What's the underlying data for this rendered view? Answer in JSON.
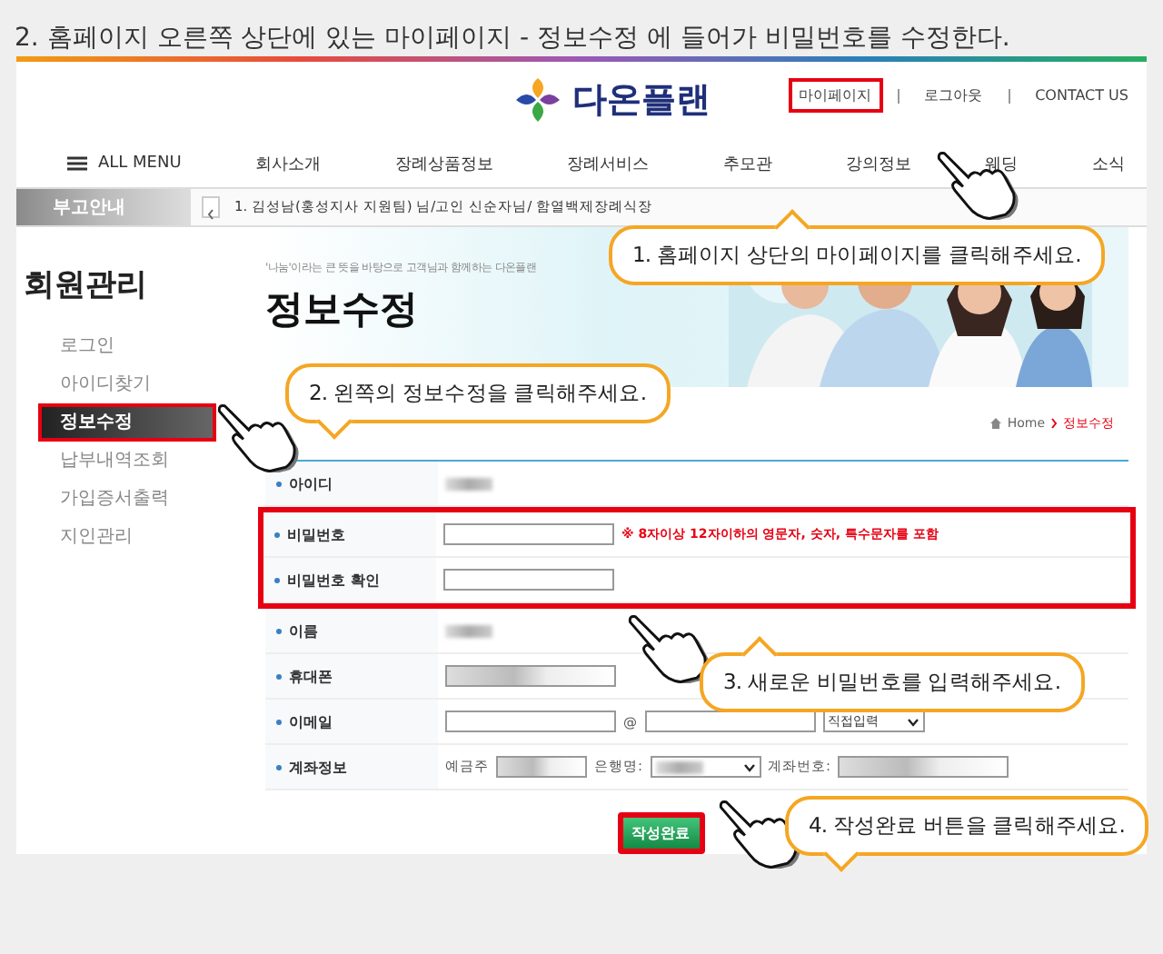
{
  "instruction": "2.  홈페이지 오른쪽 상단에 있는 마이페이지 - 정보수정 에 들어가 비밀번호를 수정한다.",
  "site": {
    "logo_text": "다온플랜",
    "top_links": [
      {
        "label": "마이페이지",
        "highlighted": true
      },
      {
        "label": "로그아웃",
        "highlighted": false
      },
      {
        "label": "CONTACT US",
        "highlighted": false
      }
    ],
    "menu_label": "ALL MENU",
    "nav": [
      "회사소개",
      "장례상품정보",
      "장례서비스",
      "추모관",
      "강의정보",
      "웨딩",
      "소식"
    ],
    "notice": {
      "label": "부고안내",
      "item": "1. 김성남(홍성지사 지원팀) 님/고인 신순자님/ 함열백제장례식장"
    }
  },
  "sidebar": {
    "title": "회원관리",
    "items": [
      {
        "label": "로그인",
        "selected": false
      },
      {
        "label": "아이디찾기",
        "selected": false
      },
      {
        "label": "정보수정",
        "selected": true
      },
      {
        "label": "납부내역조회",
        "selected": false
      },
      {
        "label": "가입증서출력",
        "selected": false
      },
      {
        "label": "지인관리",
        "selected": false
      }
    ]
  },
  "page": {
    "tagline": "'나눔'이라는 큰 뜻을 바탕으로 고객님과 함께하는 다온플랜",
    "title": "정보수정",
    "breadcrumb": [
      "Home",
      "정보수정"
    ]
  },
  "form": {
    "rows": [
      {
        "label": "아이디",
        "kind": "text",
        "highlighted": false
      },
      {
        "label": "비밀번호",
        "kind": "password",
        "highlighted": true,
        "note": "※ 8자이상 12자이하의 영문자, 숫자, 특수문자를 포함"
      },
      {
        "label": "비밀번호 확인",
        "kind": "password",
        "highlighted": true
      },
      {
        "label": "이름",
        "kind": "text",
        "highlighted": false
      },
      {
        "label": "휴대폰",
        "kind": "input",
        "highlighted": false
      },
      {
        "label": "이메일",
        "kind": "email",
        "highlighted": false,
        "at": "@",
        "select": "직접입력"
      },
      {
        "label": "계좌정보",
        "kind": "account",
        "highlighted": false,
        "holder": "예금주",
        "bank": "은행명:",
        "number": "계좌번호:"
      }
    ],
    "submit": {
      "label": "작성완료",
      "highlighted": true
    }
  },
  "callouts": [
    {
      "text": "1. 홈페이지 상단의 마이페이지를 클릭해주세요."
    },
    {
      "text": "2. 왼쪽의 정보수정을 클릭해주세요."
    },
    {
      "text": "3. 새로운 비밀번호를 입력해주세요."
    },
    {
      "text": "4. 작성완료 버튼을 클릭해주세요."
    }
  ]
}
